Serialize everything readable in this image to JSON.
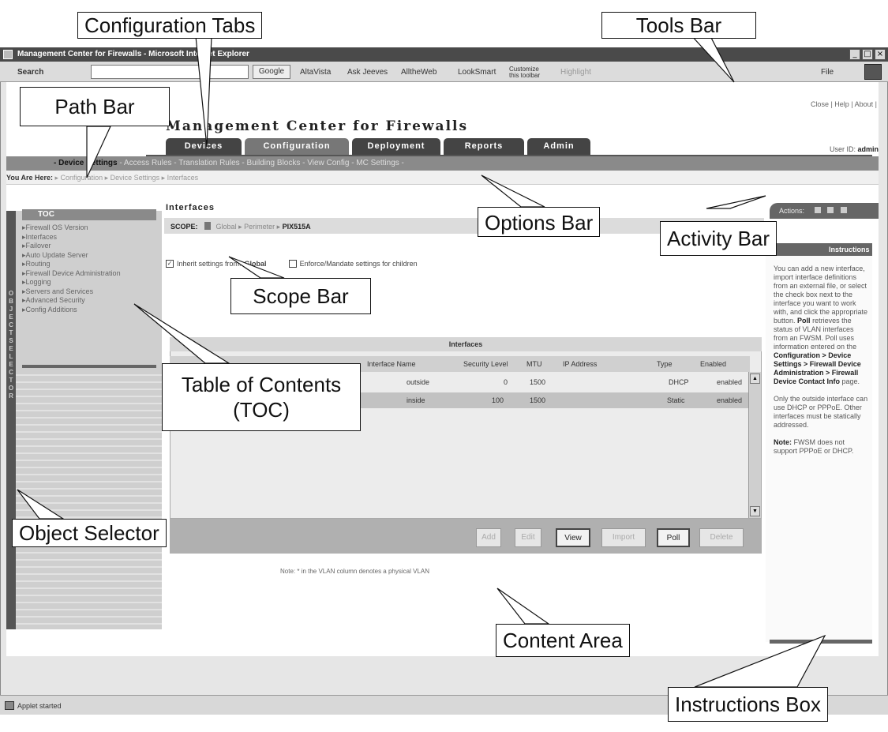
{
  "browser": {
    "title": "Management Center for Firewalls - Microsoft Internet Explorer",
    "window_buttons": [
      "_",
      "□",
      "×"
    ],
    "toolbar": {
      "search_label": "Search",
      "google_label": "Google",
      "items": [
        "AltaVista",
        "Ask Jeeves",
        "AlltheWeb",
        "LookSmart",
        "Customize this toolbar",
        "Highlight"
      ],
      "file_label": "File"
    },
    "status": "Applet started"
  },
  "app": {
    "title": "Management Center for Firewalls",
    "top_links": "Close | Help | About |",
    "user_label": "User ID:",
    "user_value": "admin",
    "tabs": [
      "Devices",
      "Configuration",
      "Deployment",
      "Reports",
      "Admin"
    ],
    "options_bar": {
      "active": "- Device Settings",
      "rest": "- Access Rules - Translation Rules - Building Blocks - View Config - MC Settings -"
    },
    "path_bar": {
      "label": "You Are Here:",
      "path": "▸ Configuration ▸ Device Settings ▸ Interfaces"
    },
    "activity_bar": {
      "label": "Actions:"
    },
    "object_selector": "OBJECT SELECTOR",
    "toc": {
      "title": "TOC",
      "items": [
        "Firewall OS Version",
        "Interfaces",
        "Failover",
        "Auto Update Server",
        "Routing",
        "Firewall Device Administration",
        "Logging",
        "Servers and Services",
        "Advanced Security",
        "Config Additions"
      ]
    },
    "content": {
      "title": "Interfaces",
      "scope_label": "SCOPE:",
      "scope_path": "Global ▸ Perimeter ▸",
      "scope_current": "PIX515A",
      "inherit_label": "Inherit settings from:",
      "inherit_value": "Global",
      "enforce_label": "Enforce/Mandate settings for children",
      "table_caption": "Interfaces",
      "columns": [
        "Interface Name",
        "Security Level",
        "MTU",
        "IP Address",
        "Type",
        "Enabled"
      ],
      "rows": [
        [
          "outside",
          "0",
          "1500",
          "",
          "DHCP",
          "enabled"
        ],
        [
          "inside",
          "100",
          "1500",
          "",
          "Static",
          "enabled"
        ]
      ],
      "buttons": [
        {
          "label": "Add",
          "enabled": false
        },
        {
          "label": "Edit",
          "enabled": false
        },
        {
          "label": "View",
          "enabled": true
        },
        {
          "label": "Import",
          "enabled": false
        },
        {
          "label": "Poll",
          "enabled": true
        },
        {
          "label": "Delete",
          "enabled": false
        }
      ],
      "note": "Note: * in the VLAN column denotes a physical VLAN"
    },
    "instructions": {
      "title": "Instructions",
      "p1_a": "You can add a new interface, import interface definitions from an external file, or select the check box next to the interface you want to work with, and click the appropriate button.",
      "p1_poll": "Poll",
      "p1_b": "retrieves the status of VLAN interfaces from an FWSM. Poll uses information entered on the",
      "p1_link": "Configuration > Device Settings > Firewall Device Administration > Firewall Device Contact Info",
      "p1_c": "page.",
      "p2": "Only the outside interface can use DHCP or PPPoE. Other interfaces must be statically addressed.",
      "p3_label": "Note:",
      "p3": "FWSM does not support PPPoE or DHCP."
    }
  },
  "callouts": {
    "configuration_tabs": "Configuration Tabs",
    "tools_bar": "Tools Bar",
    "path_bar": "Path Bar",
    "options_bar": "Options Bar",
    "activity_bar": "Activity Bar",
    "scope_bar": "Scope Bar",
    "toc_line1": "Table of Contents",
    "toc_line2": "(TOC)",
    "object_selector": "Object Selector",
    "content_area": "Content Area",
    "instructions_box": "Instructions Box"
  }
}
